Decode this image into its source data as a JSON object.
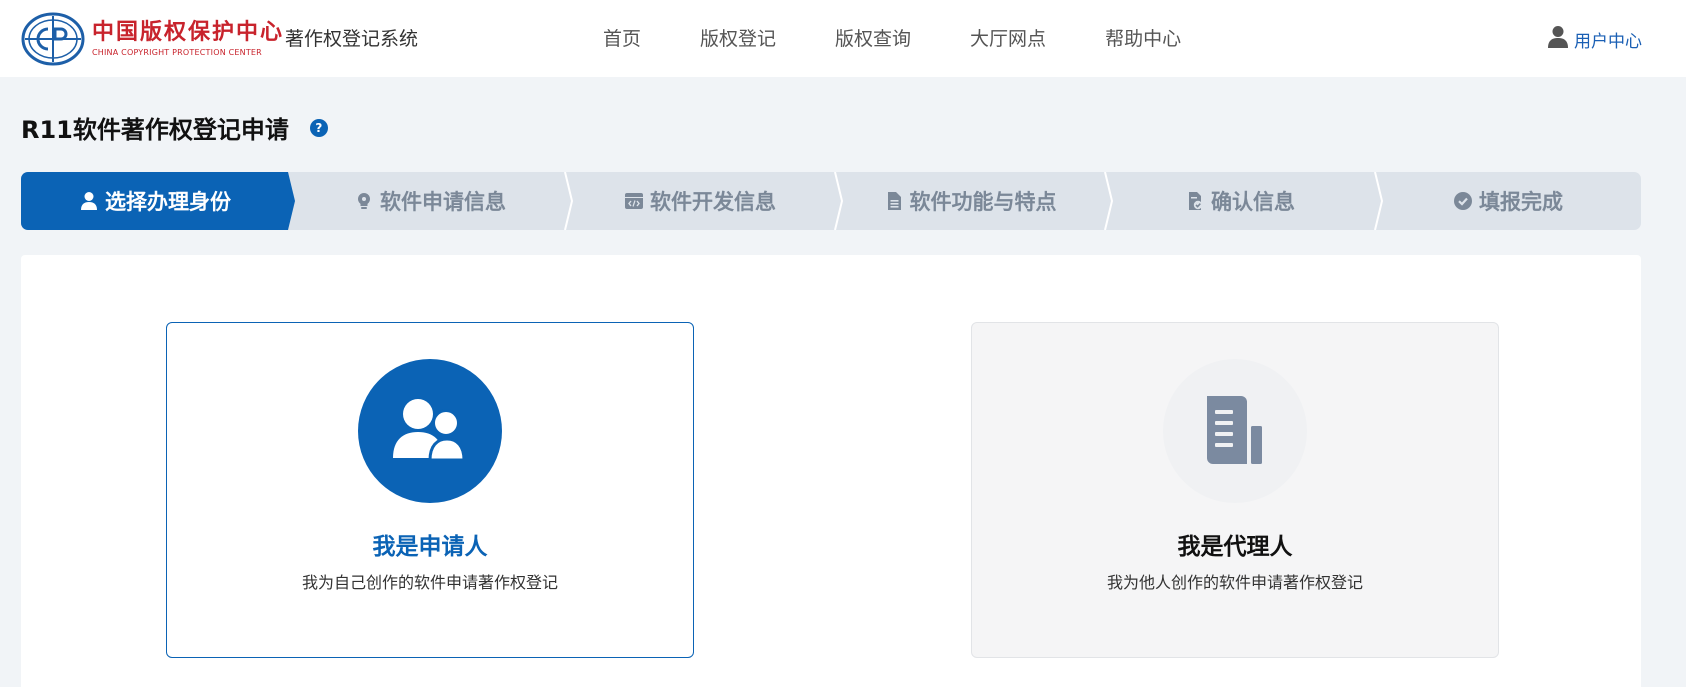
{
  "header": {
    "logo_cn": "中国版权保护中心",
    "logo_en": "CHINA COPYRIGHT PROTECTION CENTER",
    "system_name": "著作权登记系统",
    "nav": [
      "首页",
      "版权登记",
      "版权查询",
      "大厅网点",
      "帮助中心"
    ],
    "user_center": "用户中心"
  },
  "page": {
    "title": "R11软件著作权登记申请",
    "help_symbol": "?"
  },
  "stepper": {
    "active_index": 0,
    "steps": [
      {
        "label": "选择办理身份",
        "icon": "user-icon"
      },
      {
        "label": "软件申请信息",
        "icon": "lightbulb-icon"
      },
      {
        "label": "软件开发信息",
        "icon": "code-window-icon"
      },
      {
        "label": "软件功能与特点",
        "icon": "document-icon"
      },
      {
        "label": "确认信息",
        "icon": "document-check-icon"
      },
      {
        "label": "填报完成",
        "icon": "check-circle-icon"
      }
    ]
  },
  "identity_options": {
    "selected": "applicant",
    "applicant": {
      "title": "我是申请人",
      "desc": "我为自己创作的软件申请著作权登记",
      "icon": "users-icon"
    },
    "agent": {
      "title": "我是代理人",
      "desc": "我为他人创作的软件申请著作权登记",
      "icon": "document-list-icon"
    }
  },
  "colors": {
    "primary": "#0b63b5",
    "brand_red": "#c8232c",
    "step_inactive_bg": "#dde3ea",
    "step_inactive_text": "#7b8898",
    "page_bg": "#f1f4f7"
  }
}
